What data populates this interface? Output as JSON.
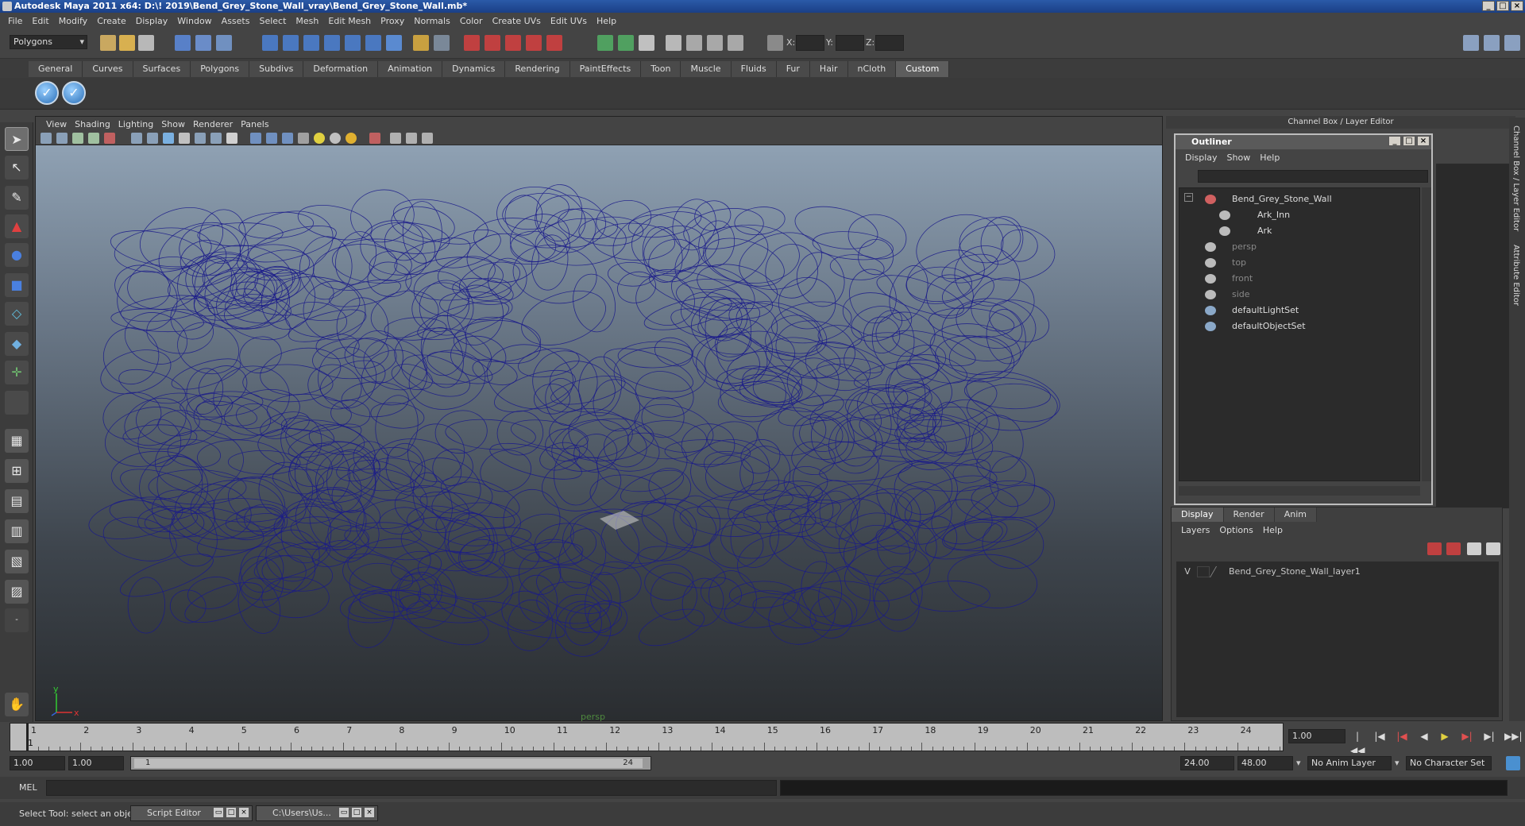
{
  "window": {
    "title": "Autodesk Maya 2011 x64: D:\\! 2019\\Bend_Grey_Stone_Wall_vray\\Bend_Grey_Stone_Wall.mb*"
  },
  "menu": [
    "File",
    "Edit",
    "Modify",
    "Create",
    "Display",
    "Window",
    "Assets",
    "Select",
    "Mesh",
    "Edit Mesh",
    "Proxy",
    "Normals",
    "Color",
    "Create UVs",
    "Edit UVs",
    "Help"
  ],
  "status": {
    "mode": "Polygons",
    "x_label": "X:",
    "y_label": "Y:",
    "z_label": "Z:"
  },
  "shelf_tabs": [
    "General",
    "Curves",
    "Surfaces",
    "Polygons",
    "Subdivs",
    "Deformation",
    "Animation",
    "Dynamics",
    "Rendering",
    "PaintEffects",
    "Toon",
    "Muscle",
    "Fluids",
    "Fur",
    "Hair",
    "nCloth",
    "Custom"
  ],
  "shelf_active": "Custom",
  "viewport": {
    "menu": [
      "View",
      "Shading",
      "Lighting",
      "Show",
      "Renderer",
      "Panels"
    ],
    "camera_label": "persp",
    "axis_y": "y",
    "axis_x": "x"
  },
  "channel_box_title": "Channel Box / Layer Editor",
  "outliner": {
    "title": "Outliner",
    "menu": [
      "Display",
      "Show",
      "Help"
    ],
    "items": [
      {
        "label": "Bend_Grey_Stone_Wall",
        "dim": false
      },
      {
        "label": "Ark_Inn",
        "dim": false
      },
      {
        "label": "Ark",
        "dim": false
      },
      {
        "label": "persp",
        "dim": true
      },
      {
        "label": "top",
        "dim": true
      },
      {
        "label": "front",
        "dim": true
      },
      {
        "label": "side",
        "dim": true
      },
      {
        "label": "defaultLightSet",
        "dim": false
      },
      {
        "label": "defaultObjectSet",
        "dim": false
      }
    ]
  },
  "side_tabs": [
    "Channel Box / Layer Editor",
    "Attribute Editor"
  ],
  "layer_editor": {
    "tabs": [
      "Display",
      "Render",
      "Anim"
    ],
    "menu": [
      "Layers",
      "Options",
      "Help"
    ],
    "layer_vis": "V",
    "layer_name": "Bend_Grey_Stone_Wall_layer1"
  },
  "timeline": {
    "ticks": [
      "1",
      "2",
      "3",
      "4",
      "5",
      "6",
      "7",
      "8",
      "9",
      "10",
      "11",
      "12",
      "13",
      "14",
      "15",
      "16",
      "17",
      "18",
      "19",
      "20",
      "21",
      "22",
      "23",
      "24"
    ],
    "current_frame": "1.00",
    "current_marker": "1"
  },
  "range": {
    "start": "1.00",
    "inner_start": "1.00",
    "bar_start": "1",
    "bar_end": "24",
    "end": "24.00",
    "outer_end": "48.00",
    "anim_layer": "No Anim Layer",
    "char_set": "No Character Set"
  },
  "mel": {
    "label": "MEL"
  },
  "help": {
    "message": "Select Tool: select an object",
    "task1": "Script Editor",
    "task2": "C:\\Users\\Us..."
  }
}
